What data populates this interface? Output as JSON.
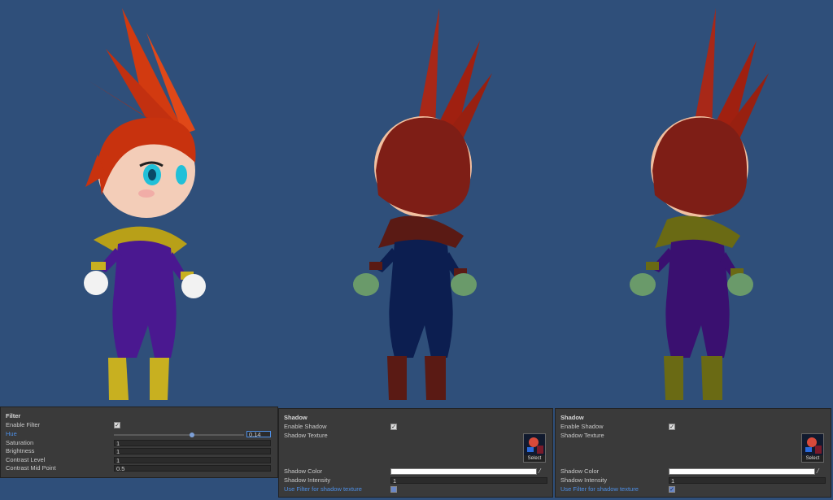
{
  "filter_panel": {
    "title": "Filter",
    "enable_filter_label": "Enable Filter",
    "enable_filter_checked": true,
    "hue_label": "Hue",
    "hue_value": "0.14",
    "hue_slider_fraction": 0.6,
    "saturation_label": "Saturation",
    "saturation_value": "1",
    "brightness_label": "Brightness",
    "brightness_value": "1",
    "contrast_level_label": "Contrast Level",
    "contrast_level_value": "1",
    "contrast_mid_label": "Contrast Mid Point",
    "contrast_mid_value": "0.5"
  },
  "shadow_panels": [
    {
      "title": "Shadow",
      "enable_shadow_label": "Enable Shadow",
      "enable_shadow_checked": true,
      "shadow_texture_label": "Shadow Texture",
      "select_label": "Select",
      "shadow_color_label": "Shadow Color",
      "shadow_color": "#ffffff",
      "shadow_intensity_label": "Shadow Intensity",
      "shadow_intensity_value": "1",
      "use_filter_label": "Use Filter for shadow texture",
      "use_filter_checked": false
    },
    {
      "title": "Shadow",
      "enable_shadow_label": "Enable Shadow",
      "enable_shadow_checked": true,
      "shadow_texture_label": "Shadow Texture",
      "select_label": "Select",
      "shadow_color_label": "Shadow Color",
      "shadow_color": "#ffffff",
      "shadow_intensity_label": "Shadow Intensity",
      "shadow_intensity_value": "1",
      "use_filter_label": "Use Filter for shadow texture",
      "use_filter_checked": true
    }
  ],
  "colors": {
    "scene_background": "#2f4f7a",
    "panel_background": "#3a3a3a",
    "accent_blue": "#4d8fe6"
  },
  "icons": {
    "checkbox": "check-mark",
    "color_picker": "eyedropper-icon"
  }
}
